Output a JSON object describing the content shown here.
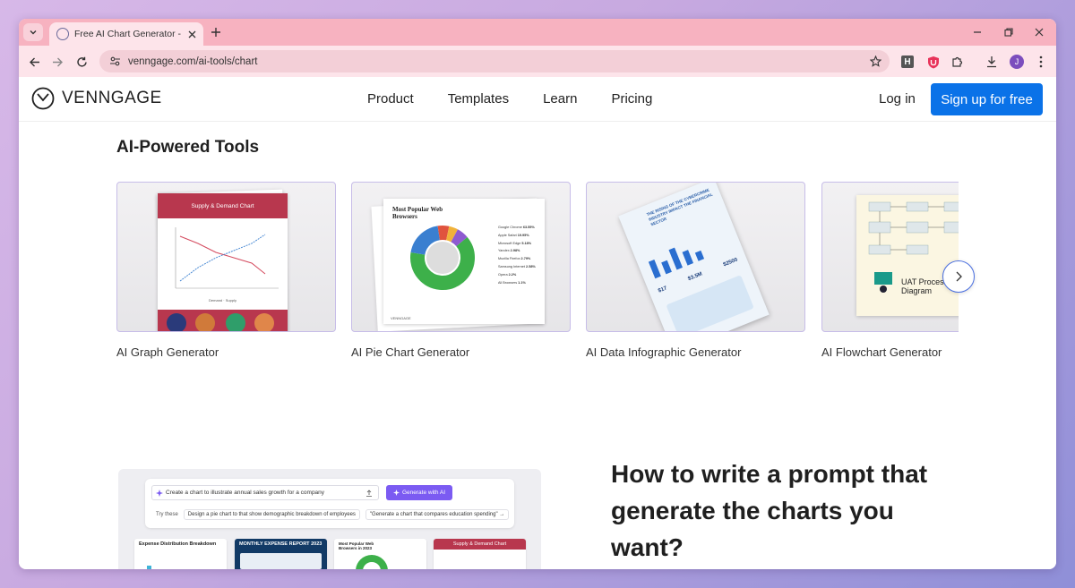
{
  "browser": {
    "tab_title": "Free AI Chart Generator - Make",
    "url": "venngage.com/ai-tools/chart",
    "profile_initial": "J",
    "extension_h_label": "H",
    "colors": {
      "tabstrip": "#f7b2c0",
      "toolbar": "#fde4ea",
      "omnibox": "#f3cfd7"
    }
  },
  "header": {
    "logo_text": "VENNGAGE",
    "nav": [
      "Product",
      "Templates",
      "Learn",
      "Pricing"
    ],
    "login": "Log in",
    "signup": "Sign up for free",
    "accent": "#0a72e8"
  },
  "tools": {
    "title": "AI-Powered Tools",
    "cards": [
      {
        "label": "AI Graph Generator",
        "thumb_title": "Supply & Demand Chart",
        "legend": [
          "Demand",
          "Supply"
        ]
      },
      {
        "label": "AI Pie Chart Generator",
        "thumb_title": "Most Popular Web Browsers",
        "slices": [
          {
            "name": "Google Chrome",
            "value": "63.55%"
          },
          {
            "name": "Apple Safari",
            "value": "19.95%"
          },
          {
            "name": "Microsoft Edge",
            "value": "5.18%"
          },
          {
            "name": "Yandex",
            "value": "2.98%"
          },
          {
            "name": "Mozilla Firefox",
            "value": "2.79%"
          },
          {
            "name": "Samsung Internet",
            "value": "2.58%"
          },
          {
            "name": "Opera",
            "value": "2.2%"
          },
          {
            "name": "All Browsers",
            "value": "1.1%"
          }
        ],
        "footer_brand": "VENNGAGE"
      },
      {
        "label": "AI Data Infographic Generator",
        "thumb_title": "THE RISING OF THE CYBERCRIME INDUSTRY IMPACT THE FINANCIAL SECTOR",
        "stats": [
          "$17",
          "$3.5M",
          "$2500"
        ]
      },
      {
        "label": "AI Flowchart Generator",
        "thumb_title": "UAT Process Flow Diagram"
      }
    ]
  },
  "demo": {
    "prompt_text": "Create a chart to illustrate annual sales growth for a company",
    "generate_label": "Generate with AI",
    "try_label": "Try these",
    "suggestions": [
      "Design a pie chart to that show demographic breakdown of employees",
      "\"Generate a chart that compares education spending\" →"
    ],
    "mini_cards": [
      "Expense Distribution Breakdown",
      "MONTHLY EXPENSE REPORT 2023",
      "Most Popular Web Browsers in 2023",
      "Supply & Demand Chart"
    ]
  },
  "howto": {
    "heading": "How to write a prompt that generate the charts you want?"
  }
}
